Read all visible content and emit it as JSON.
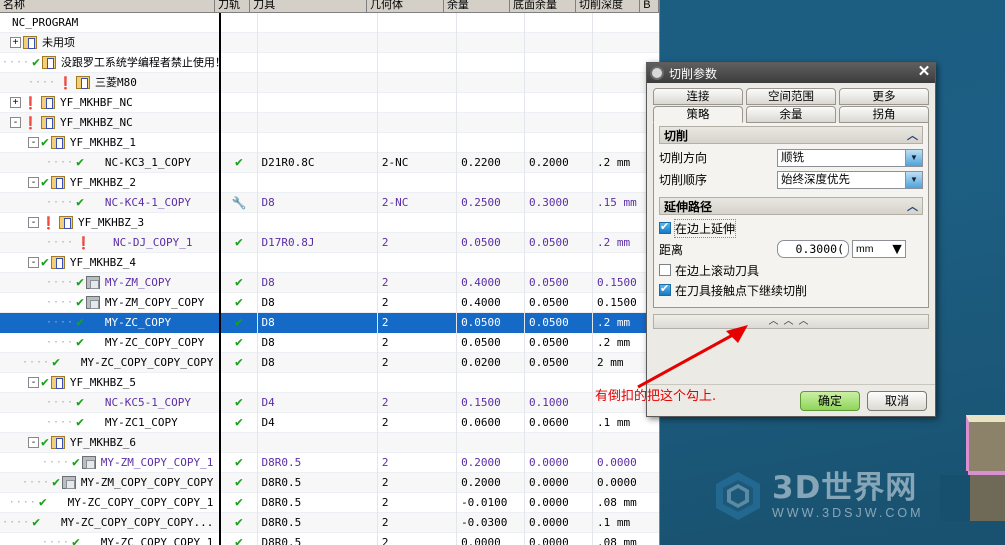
{
  "window": {
    "viewport_bg": "#1d5c7e"
  },
  "op_navigator": {
    "columns": [
      {
        "key": "name",
        "label": "名称"
      },
      {
        "key": "path",
        "label": "刀轨"
      },
      {
        "key": "tool",
        "label": "刀具"
      },
      {
        "key": "geo",
        "label": "几何体"
      },
      {
        "key": "stock",
        "label": "余量"
      },
      {
        "key": "floor",
        "label": "底面余量"
      },
      {
        "key": "depth",
        "label": "切削深度"
      },
      {
        "key": "extra",
        "label": "B"
      }
    ],
    "rows": [
      {
        "indent": 0,
        "toggle": "",
        "status": "",
        "icon": "",
        "name": "NC_PROGRAM",
        "path": "",
        "tool": "",
        "geo": "",
        "stock": "",
        "floor": "",
        "depth": "",
        "purple": false,
        "selected": false
      },
      {
        "indent": 0,
        "toggle": "+",
        "status": "",
        "icon": "folder",
        "name": "未用项",
        "path": "",
        "tool": "",
        "geo": "",
        "stock": "",
        "floor": "",
        "depth": "",
        "purple": false,
        "selected": false
      },
      {
        "indent": 1,
        "toggle": "",
        "status": "ok",
        "icon": "folder",
        "name": "没跟罗工系统学编程者禁止使用！",
        "path": "",
        "tool": "",
        "geo": "",
        "stock": "",
        "floor": "",
        "depth": "",
        "purple": false,
        "selected": false
      },
      {
        "indent": 1,
        "toggle": "",
        "status": "warn",
        "icon": "folder",
        "name": "三菱M80",
        "path": "",
        "tool": "",
        "geo": "",
        "stock": "",
        "floor": "",
        "depth": "",
        "purple": false,
        "selected": false
      },
      {
        "indent": 0,
        "toggle": "+",
        "status": "warn",
        "icon": "folder",
        "name": "YF_MKHBF_NC",
        "path": "",
        "tool": "",
        "geo": "",
        "stock": "",
        "floor": "",
        "depth": "",
        "purple": false,
        "selected": false
      },
      {
        "indent": 0,
        "toggle": "-",
        "status": "warn",
        "icon": "folder",
        "name": "YF_MKHBZ_NC",
        "path": "",
        "tool": "",
        "geo": "",
        "stock": "",
        "floor": "",
        "depth": "",
        "purple": false,
        "selected": false
      },
      {
        "indent": 1,
        "toggle": "-",
        "status": "ok",
        "icon": "folder",
        "name": "YF_MKHBZ_1",
        "path": "",
        "tool": "",
        "geo": "",
        "stock": "",
        "floor": "",
        "depth": "",
        "purple": false,
        "selected": false
      },
      {
        "indent": 2,
        "toggle": "",
        "status": "ok",
        "icon": "operation",
        "name": "NC-KC3_1_COPY",
        "path": "ok",
        "tool": "D21R0.8C",
        "geo": "2-NC",
        "stock": "0.2200",
        "floor": "0.2000",
        "depth": ".2 mm",
        "purple": false,
        "selected": false
      },
      {
        "indent": 1,
        "toggle": "-",
        "status": "ok",
        "icon": "folder",
        "name": "YF_MKHBZ_2",
        "path": "",
        "tool": "",
        "geo": "",
        "stock": "",
        "floor": "",
        "depth": "",
        "purple": false,
        "selected": false
      },
      {
        "indent": 2,
        "toggle": "",
        "status": "ok",
        "icon": "operation",
        "name": "NC-KC4-1_COPY",
        "path": "wrench",
        "tool": "D8",
        "geo": "2-NC",
        "stock": "0.2500",
        "floor": "0.3000",
        "depth": ".15 mm",
        "purple": true,
        "selected": false
      },
      {
        "indent": 1,
        "toggle": "-",
        "status": "warn",
        "icon": "folder",
        "name": "YF_MKHBZ_3",
        "path": "",
        "tool": "",
        "geo": "",
        "stock": "",
        "floor": "",
        "depth": "",
        "purple": false,
        "selected": false
      },
      {
        "indent": 2,
        "toggle": "",
        "status": "warn",
        "icon": "operation",
        "name": "NC-DJ_COPY_1",
        "path": "ok",
        "tool": "D17R0.8J",
        "geo": "2",
        "stock": "0.0500",
        "floor": "0.0500",
        "depth": ".2 mm",
        "purple": true,
        "selected": false
      },
      {
        "indent": 1,
        "toggle": "-",
        "status": "ok",
        "icon": "folder",
        "name": "YF_MKHBZ_4",
        "path": "",
        "tool": "",
        "geo": "",
        "stock": "",
        "floor": "",
        "depth": "",
        "purple": false,
        "selected": false
      },
      {
        "indent": 2,
        "toggle": "",
        "status": "ok",
        "icon": "mill",
        "name": "MY-ZM_COPY",
        "path": "ok",
        "tool": "D8",
        "geo": "2",
        "stock": "0.4000",
        "floor": "0.0500",
        "depth": "0.1500",
        "purple": true,
        "selected": false
      },
      {
        "indent": 2,
        "toggle": "",
        "status": "ok",
        "icon": "mill",
        "name": "MY-ZM_COPY_COPY",
        "path": "ok",
        "tool": "D8",
        "geo": "2",
        "stock": "0.4000",
        "floor": "0.0500",
        "depth": "0.1500",
        "purple": false,
        "selected": false
      },
      {
        "indent": 2,
        "toggle": "",
        "status": "ok",
        "icon": "operation",
        "name": "MY-ZC_COPY",
        "path": "ok",
        "tool": "D8",
        "geo": "2",
        "stock": "0.0500",
        "floor": "0.0500",
        "depth": ".2 mm",
        "purple": false,
        "selected": true
      },
      {
        "indent": 2,
        "toggle": "",
        "status": "ok",
        "icon": "operation",
        "name": "MY-ZC_COPY_COPY",
        "path": "ok",
        "tool": "D8",
        "geo": "2",
        "stock": "0.0500",
        "floor": "0.0500",
        "depth": ".2 mm",
        "purple": false,
        "selected": false
      },
      {
        "indent": 2,
        "toggle": "",
        "status": "ok",
        "icon": "operation",
        "name": "MY-ZC_COPY_COPY_COPY",
        "path": "ok",
        "tool": "D8",
        "geo": "2",
        "stock": "0.0200",
        "floor": "0.0500",
        "depth": "2 mm",
        "purple": false,
        "selected": false
      },
      {
        "indent": 1,
        "toggle": "-",
        "status": "ok",
        "icon": "folder",
        "name": "YF_MKHBZ_5",
        "path": "",
        "tool": "",
        "geo": "",
        "stock": "",
        "floor": "",
        "depth": "",
        "purple": false,
        "selected": false
      },
      {
        "indent": 2,
        "toggle": "",
        "status": "ok",
        "icon": "operation",
        "name": "NC-KC5-1_COPY",
        "path": "ok",
        "tool": "D4",
        "geo": "2",
        "stock": "0.1500",
        "floor": "0.1000",
        "depth": "",
        "purple": true,
        "selected": false
      },
      {
        "indent": 2,
        "toggle": "",
        "status": "ok",
        "icon": "operation",
        "name": "MY-ZC1_COPY",
        "path": "ok",
        "tool": "D4",
        "geo": "2",
        "stock": "0.0600",
        "floor": "0.0600",
        "depth": ".1 mm",
        "purple": false,
        "selected": false
      },
      {
        "indent": 1,
        "toggle": "-",
        "status": "ok",
        "icon": "folder",
        "name": "YF_MKHBZ_6",
        "path": "",
        "tool": "",
        "geo": "",
        "stock": "",
        "floor": "",
        "depth": "",
        "purple": false,
        "selected": false
      },
      {
        "indent": 2,
        "toggle": "",
        "status": "ok",
        "icon": "mill",
        "name": "MY-ZM_COPY_COPY_1",
        "path": "ok",
        "tool": "D8R0.5",
        "geo": "2",
        "stock": "0.2000",
        "floor": "0.0000",
        "depth": "0.0000",
        "purple": true,
        "selected": false
      },
      {
        "indent": 2,
        "toggle": "",
        "status": "ok",
        "icon": "mill",
        "name": "MY-ZM_COPY_COPY_COPY",
        "path": "ok",
        "tool": "D8R0.5",
        "geo": "2",
        "stock": "0.2000",
        "floor": "0.0000",
        "depth": "0.0000",
        "purple": false,
        "selected": false
      },
      {
        "indent": 2,
        "toggle": "",
        "status": "ok",
        "icon": "operation",
        "name": "MY-ZC_COPY_COPY_COPY_1",
        "path": "ok",
        "tool": "D8R0.5",
        "geo": "2",
        "stock": "-0.0100",
        "floor": "0.0000",
        "depth": ".08 mm",
        "purple": false,
        "selected": false
      },
      {
        "indent": 2,
        "toggle": "",
        "status": "ok",
        "icon": "operation",
        "name": "MY-ZC_COPY_COPY_COPY...",
        "path": "ok",
        "tool": "D8R0.5",
        "geo": "2",
        "stock": "-0.0300",
        "floor": "0.0000",
        "depth": ".1 mm",
        "purple": false,
        "selected": false
      },
      {
        "indent": 2,
        "toggle": "",
        "status": "ok",
        "icon": "operation",
        "name": "MY-ZC COPY COPY 1",
        "path": "ok",
        "tool": "D8R0.5",
        "geo": "2",
        "stock": "0.0000",
        "floor": "0.0000",
        "depth": ".08 mm",
        "purple": false,
        "selected": false
      }
    ]
  },
  "dialog": {
    "title": "切削参数",
    "close_label": "✕",
    "tabs_row1": [
      "连接",
      "空间范围",
      "更多"
    ],
    "tabs_row2": [
      "策略",
      "余量",
      "拐角"
    ],
    "active_tab": "策略",
    "section_cutting": {
      "title": "切削",
      "collapse_glyph": "︿"
    },
    "cut_direction": {
      "label": "切削方向",
      "value": "顺铣"
    },
    "cut_order": {
      "label": "切削顺序",
      "value": "始终深度优先"
    },
    "section_extend": {
      "title": "延伸路径",
      "collapse_glyph": "︿"
    },
    "extend_on_edge": {
      "label": "在边上延伸",
      "checked": true
    },
    "distance": {
      "label": "距离",
      "value": "0.3000(",
      "unit": "mm"
    },
    "roll_tool_on_edge": {
      "label": "在边上滚动刀具",
      "checked": false
    },
    "cut_below_contact": {
      "label": "在刀具接触点下继续切削",
      "checked": true
    },
    "expander_glyph": "︿︿︿",
    "ok_label": "确定",
    "cancel_label": "取消"
  },
  "annotation": {
    "text": "有倒扣的把这个勾上.",
    "color": "#e60000"
  },
  "watermark": {
    "title": "3D世界网",
    "url": "WWW.3DSJW.COM"
  }
}
